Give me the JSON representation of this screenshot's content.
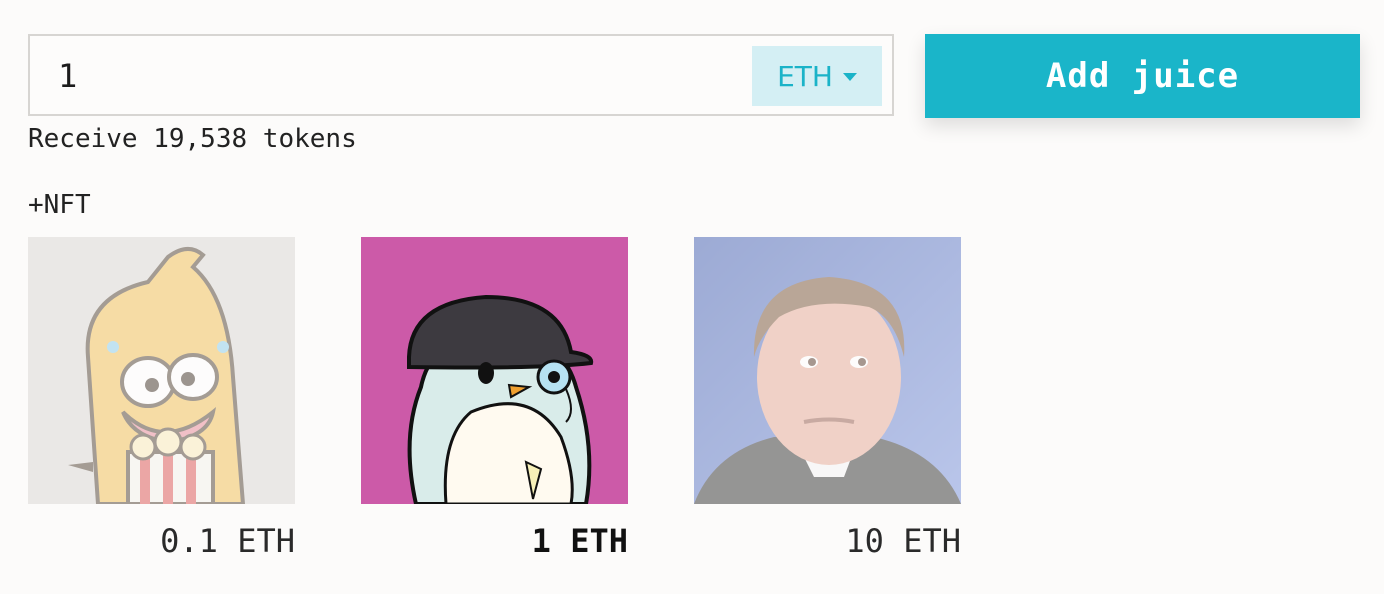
{
  "amount": {
    "value": "1",
    "currency": "ETH"
  },
  "add_button": {
    "label": "Add juice"
  },
  "receive_text": "Receive 19,538 tokens",
  "nft_section_label": "+NFT",
  "nfts": [
    {
      "price": "0.1 ETH",
      "icon": "banana-character-icon",
      "selected": false
    },
    {
      "price": "1 ETH",
      "icon": "penguin-with-cap-icon",
      "selected": true
    },
    {
      "price": "10 ETH",
      "icon": "man-portrait-icon",
      "selected": false
    }
  ],
  "colors": {
    "accent": "#1ab5c9",
    "currency_bg": "#d4eff4",
    "page_bg": "#fcfbfa"
  }
}
